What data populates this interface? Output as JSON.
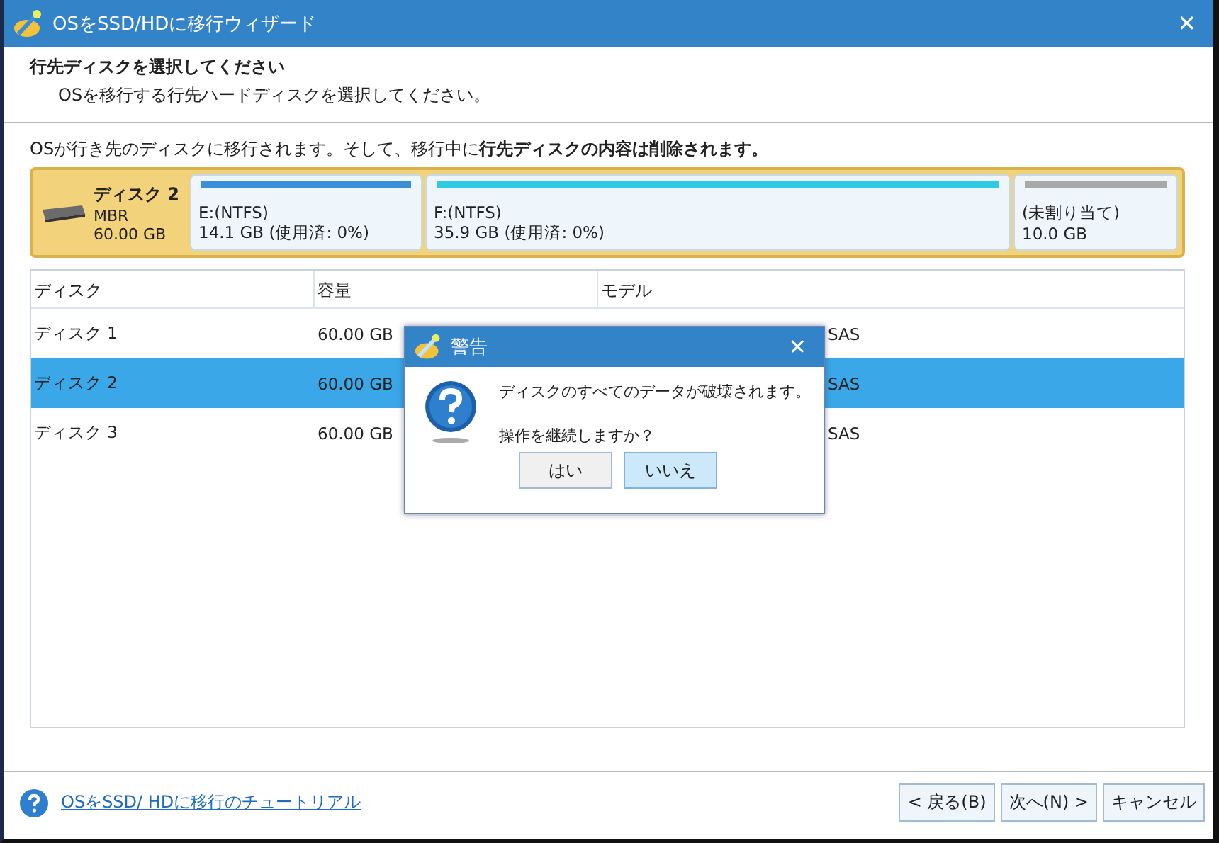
{
  "window": {
    "title": "OSをSSD/HDに移行ウィザード",
    "close": "✕"
  },
  "header": {
    "title": "行先ディスクを選択してください",
    "subtitle": "OSを移行する行先ハードディスクを選択してください。"
  },
  "info": "OSが行き先のディスクに移行されます。そして、移行中に**行先ディスクの内容は削除されます。**",
  "disk_map": {
    "name": "ディスク 2",
    "type": "MBR",
    "size": "60.00 GB",
    "partitions": [
      {
        "label": "E:(NTFS)",
        "detail": "14.1 GB (使用済: 0%)",
        "color": "#3a8fd6"
      },
      {
        "label": "F:(NTFS)",
        "detail": "35.9 GB (使用済: 0%)",
        "color": "#2ecbe6"
      },
      {
        "label": "(未割り当て)",
        "detail": "10.0 GB",
        "color": "#a8a8a8"
      }
    ]
  },
  "table": {
    "columns": [
      "ディスク",
      "容量",
      "モデル"
    ],
    "rows": [
      {
        "disk": "ディスク 1",
        "capacity": "60.00 GB",
        "model": "SAS",
        "selected": false
      },
      {
        "disk": "ディスク 2",
        "capacity": "60.00 GB",
        "model": "SAS",
        "selected": true
      },
      {
        "disk": "ディスク 3",
        "capacity": "60.00 GB",
        "model": "SAS",
        "selected": false
      }
    ]
  },
  "dialog": {
    "title": "警告",
    "close": "✕",
    "message": "ディスクのすべてのデータが破壊されます。",
    "question": "操作を継続しますか？",
    "buttons": [
      {
        "label": "はい",
        "focused": false
      },
      {
        "label": "いいえ",
        "focused": true
      }
    ]
  },
  "footer": {
    "link": "OSをSSD/ HDに移行のチュートリアル",
    "buttons": [
      "< 戻る(B)",
      "次へ(N) >",
      "キャンセル"
    ]
  }
}
